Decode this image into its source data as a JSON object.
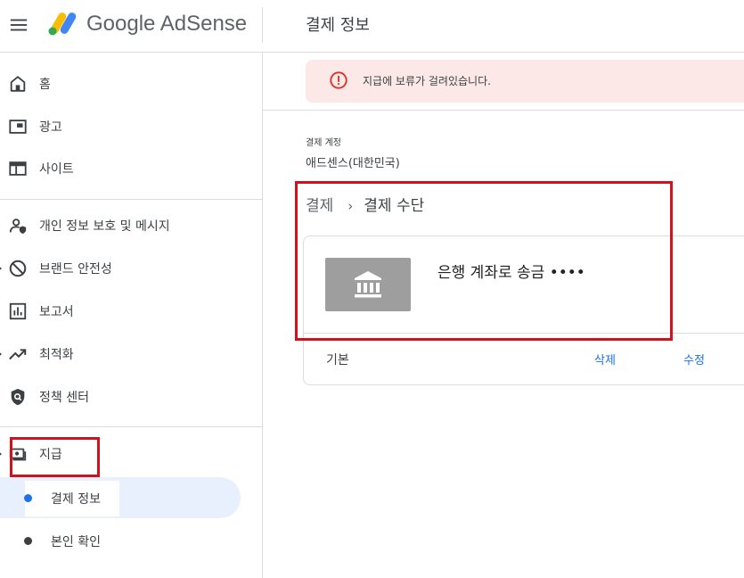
{
  "header": {
    "logo_text": "Google AdSense",
    "page_title": "결제 정보",
    "icons": [
      "menu-icon",
      "adsense-logo-icon"
    ]
  },
  "sidebar": {
    "items": [
      {
        "label": "홈",
        "icon": "home-icon"
      },
      {
        "label": "광고",
        "icon": "ads-icon"
      },
      {
        "label": "사이트",
        "icon": "sites-icon"
      },
      {
        "label": "개인 정보 보호 및 메시지",
        "icon": "privacy-icon"
      },
      {
        "label": "브랜드 안전성",
        "icon": "block-icon"
      },
      {
        "label": "보고서",
        "icon": "reports-icon"
      },
      {
        "label": "최적화",
        "icon": "trending-icon"
      },
      {
        "label": "정책 센터",
        "icon": "policy-icon"
      },
      {
        "label": "지급",
        "icon": "payments-icon"
      }
    ],
    "subitems": [
      {
        "label": "결제 정보",
        "active": true
      },
      {
        "label": "본인 확인",
        "active": false
      }
    ]
  },
  "alert": {
    "text": "지급에 보류가 걸려있습니다.",
    "icon": "error-icon",
    "background": "#fce8e6",
    "icon_color": "#d93025"
  },
  "account": {
    "label": "결제 계정",
    "value": "애드센스(대한민국)"
  },
  "breadcrumb": {
    "items": [
      "결제",
      "결제 수단"
    ],
    "separator": "›"
  },
  "payment_method": {
    "label": "은행 계좌로 송금 ••••",
    "icon": "bank-icon",
    "default_label": "기본",
    "delete_label": "삭제",
    "edit_label": "수정"
  },
  "colors": {
    "accent": "#1a73e8",
    "active_nav_bg": "#e8f0fe",
    "annotation_red": "#d0121e",
    "bank_tile": "#9e9e9e"
  }
}
